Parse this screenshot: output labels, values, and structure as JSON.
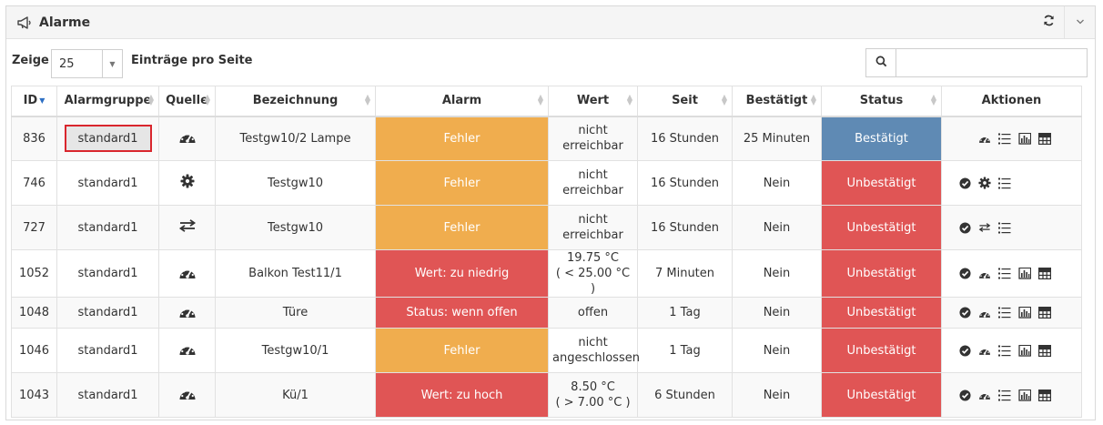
{
  "header": {
    "title": "Alarme"
  },
  "controls": {
    "show_label": "Zeige",
    "page_length": "25",
    "per_page_label": "Einträge pro Seite",
    "search_value": ""
  },
  "columns": [
    "ID",
    "Alarmgruppe",
    "Quelle",
    "Bezeichnung",
    "Alarm",
    "Wert",
    "Seit",
    "Bestätigt",
    "Status",
    "Aktionen"
  ],
  "rows": [
    {
      "id": "836",
      "group": "standard1",
      "source": "gauge",
      "name": "Testgw10/2 Lampe",
      "alarm": "Fehler",
      "alarm_type": "orange",
      "value": [
        "nicht",
        "erreichbar"
      ],
      "since": "16 Stunden",
      "confirmed": "25 Minuten",
      "status": "Bestätigt",
      "status_type": "blue",
      "actions": [
        "gauge",
        "list",
        "chart",
        "table"
      ]
    },
    {
      "id": "746",
      "group": "standard1",
      "source": "gear",
      "name": "Testgw10",
      "alarm": "Fehler",
      "alarm_type": "orange",
      "value": [
        "nicht",
        "erreichbar"
      ],
      "since": "16 Stunden",
      "confirmed": "Nein",
      "status": "Unbestätigt",
      "status_type": "red",
      "actions": [
        "check",
        "gear",
        "list"
      ]
    },
    {
      "id": "727",
      "group": "standard1",
      "source": "exchange",
      "name": "Testgw10",
      "alarm": "Fehler",
      "alarm_type": "orange",
      "value": [
        "nicht",
        "erreichbar"
      ],
      "since": "16 Stunden",
      "confirmed": "Nein",
      "status": "Unbestätigt",
      "status_type": "red",
      "actions": [
        "check",
        "exchange",
        "list"
      ]
    },
    {
      "id": "1052",
      "group": "standard1",
      "source": "gauge",
      "name": "Balkon Test11/1",
      "alarm": "Wert: zu niedrig",
      "alarm_type": "red",
      "value": [
        "19.75 °C",
        "( < 25.00 °C )"
      ],
      "since": "7 Minuten",
      "confirmed": "Nein",
      "status": "Unbestätigt",
      "status_type": "red",
      "actions": [
        "check",
        "gauge",
        "list",
        "chart",
        "table"
      ]
    },
    {
      "id": "1048",
      "group": "standard1",
      "source": "gauge",
      "name": "Türe",
      "alarm": "Status: wenn offen",
      "alarm_type": "red",
      "value": [
        "offen"
      ],
      "since": "1 Tag",
      "confirmed": "Nein",
      "status": "Unbestätigt",
      "status_type": "red",
      "actions": [
        "check",
        "gauge",
        "list",
        "chart",
        "table"
      ]
    },
    {
      "id": "1046",
      "group": "standard1",
      "source": "gauge",
      "name": "Testgw10/1",
      "alarm": "Fehler",
      "alarm_type": "orange",
      "value": [
        "nicht",
        "angeschlossen"
      ],
      "since": "1 Tag",
      "confirmed": "Nein",
      "status": "Unbestätigt",
      "status_type": "red",
      "actions": [
        "check",
        "gauge",
        "list",
        "chart",
        "table"
      ]
    },
    {
      "id": "1043",
      "group": "standard1",
      "source": "gauge",
      "name": "Kü/1",
      "alarm": "Wert: zu hoch",
      "alarm_type": "red",
      "value": [
        "8.50 °C",
        "( > 7.00 °C )"
      ],
      "since": "6 Stunden",
      "confirmed": "Nein",
      "status": "Unbestätigt",
      "status_type": "red",
      "actions": [
        "check",
        "gauge",
        "list",
        "chart",
        "table"
      ]
    }
  ],
  "colors": {
    "alarm_orange": "#f0ad4e",
    "alarm_red": "#e05555",
    "status_blue": "#5f8ab4",
    "highlight_border": "#d9262d"
  }
}
